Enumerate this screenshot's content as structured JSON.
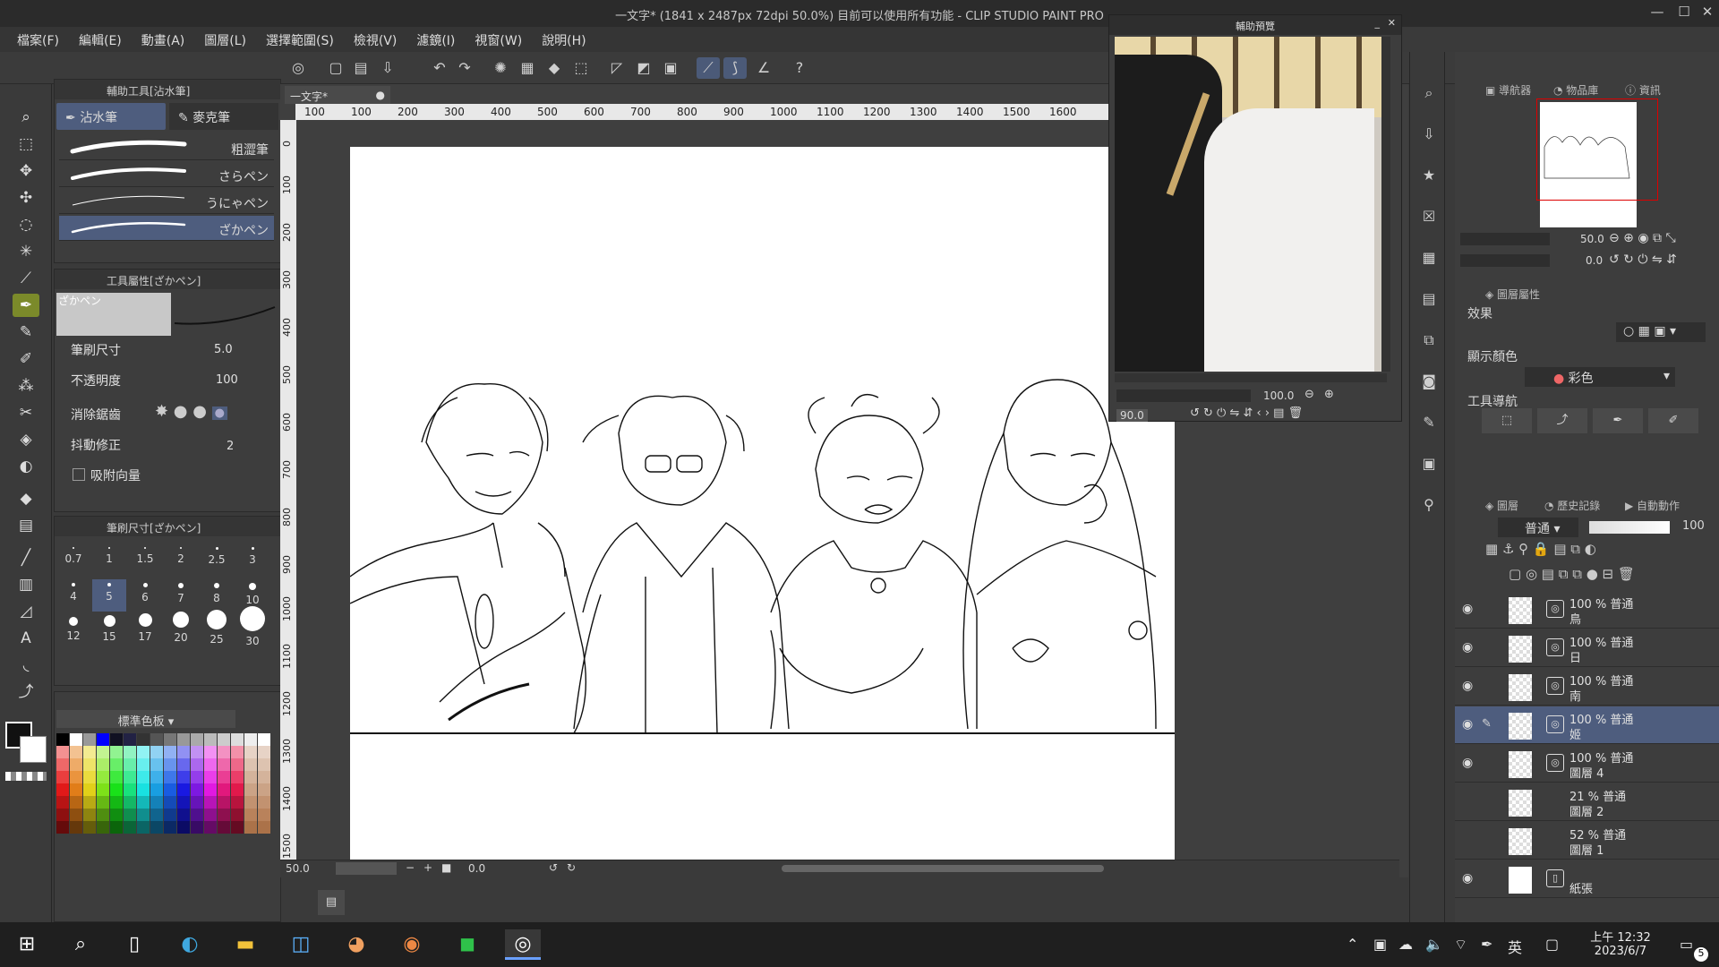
{
  "window": {
    "title": "一文字* (1841 x 2487px 72dpi 50.0%)  目前可以使用所有功能 - CLIP STUDIO PAINT PRO"
  },
  "menu": [
    "檔案(F)",
    "編輯(E)",
    "動畫(A)",
    "圖層(L)",
    "選擇範圍(S)",
    "檢視(V)",
    "濾鏡(I)",
    "視窗(W)",
    "說明(H)"
  ],
  "subtool": {
    "header": "輔助工具[沾水筆]",
    "tab_pen": "沾水筆",
    "tab_marker": "麥克筆",
    "brushes": [
      "粗澀筆",
      "さらペン",
      "うにゃペン",
      "ざかペン"
    ]
  },
  "toolprop": {
    "header": "工具屬性[ざかペン]",
    "preview_label": "ざかペン",
    "brush_size_label": "筆刷尺寸",
    "brush_size_value": "5.0",
    "opacity_label": "不透明度",
    "opacity_value": "100",
    "antialias_label": "消除鋸齒",
    "stabilization_label": "抖動修正",
    "stabilization_value": "2",
    "vector_snap_label": "吸附向量"
  },
  "brushsize": {
    "header": "筆刷尺寸[ざかペン]",
    "sizes": [
      "0.7",
      "1",
      "1.5",
      "2",
      "2.5",
      "3",
      "4",
      "5",
      "6",
      "7",
      "8",
      "10",
      "12",
      "15",
      "17",
      "20",
      "25",
      "30"
    ]
  },
  "palette": {
    "name": "標準色板"
  },
  "canvas": {
    "doc_tab": "一文字*",
    "ruler_h": [
      "100",
      "100",
      "200",
      "300",
      "400",
      "500",
      "600",
      "700",
      "800",
      "900",
      "1000",
      "1100",
      "1200",
      "1300",
      "1400",
      "1500",
      "1600"
    ],
    "ruler_v": [
      "0",
      "100",
      "200",
      "300",
      "400",
      "500",
      "600",
      "700",
      "800",
      "900",
      "1000",
      "1100",
      "1200",
      "1300",
      "1400",
      "1500"
    ],
    "status_zoom": "50.0",
    "status_angle": "0.0"
  },
  "subview": {
    "title": "輔助預覽",
    "zoom": "100.0",
    "angle": "90.0"
  },
  "navigator": {
    "tab1": "導航器",
    "tab2": "物品庫",
    "tab3": "資訊",
    "zoom": "50.0",
    "angle": "0.0"
  },
  "layerprop": {
    "tab": "圖層屬性",
    "effect_label": "效果",
    "display_color_label": "顯示顏色",
    "display_color_value": "彩色",
    "tool_nav_label": "工具導航"
  },
  "layers": {
    "tab1": "圖層",
    "tab2": "歷史記錄",
    "tab3": "自動動作",
    "blend_mode": "普通",
    "opacity": "100",
    "items": [
      {
        "line1": "100 % 普通",
        "line2": "鳥",
        "visible": true
      },
      {
        "line1": "100 % 普通",
        "line2": "日",
        "visible": true
      },
      {
        "line1": "100 % 普通",
        "line2": "南",
        "visible": true
      },
      {
        "line1": "100 % 普通",
        "line2": "姬",
        "visible": true
      },
      {
        "line1": "100 % 普通",
        "line2": "圖層 4",
        "visible": true
      },
      {
        "line1": "21 % 普通",
        "line2": "圖層 2",
        "visible": false
      },
      {
        "line1": "52 % 普通",
        "line2": "圖層 1",
        "visible": false
      },
      {
        "line1": "",
        "line2": "紙張",
        "visible": true
      }
    ]
  },
  "taskbar": {
    "time": "上午 12:32",
    "date": "2023/6/7",
    "ime": "英",
    "notifications": "5"
  },
  "colors": {
    "accent": "#4e5d7e",
    "tool_active": "#7b8a2a",
    "taskbar": "#1f1f1f"
  }
}
